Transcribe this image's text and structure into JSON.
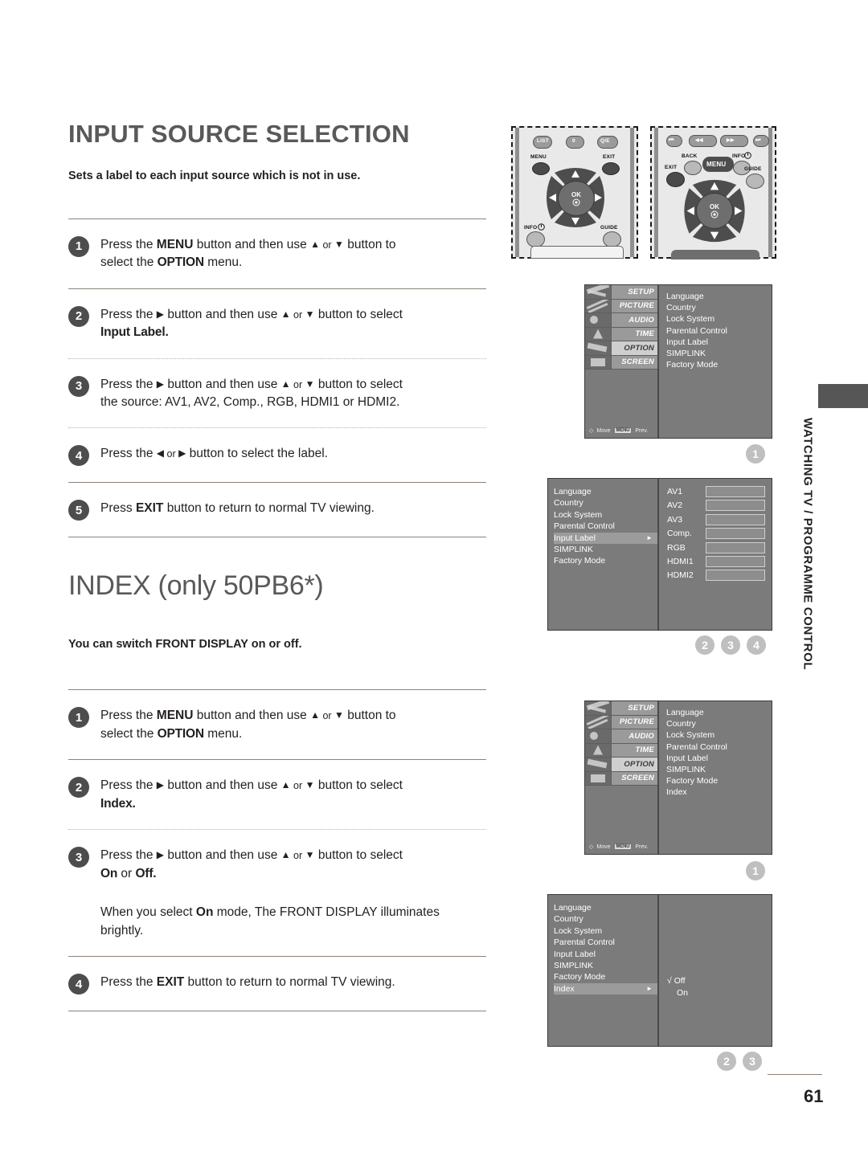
{
  "page": {
    "number": "61",
    "side_tab_text": "WATCHING TV / PROGRAMME CONTROL"
  },
  "section1": {
    "title": "INPUT SOURCE SELECTION",
    "lead": "Sets a label to each input source which is not in use.",
    "steps": [
      {
        "num": "1",
        "line1_a": "Press the ",
        "bold1": "MENU",
        "line1_b": " button and then use ",
        "up": "▲",
        "or": " or ",
        "down": "▼",
        "line1_c": " button to",
        "line2_a": "select the ",
        "bold2": "OPTION",
        "line2_b": " menu."
      },
      {
        "num": "2",
        "line1_a": "Press the ",
        "right": "▶",
        "line1_b": " button and then use ",
        "up": "▲",
        "or": " or ",
        "down": "▼",
        "line1_c": " button to select",
        "line2_bold": "Input Label."
      },
      {
        "num": "3",
        "line1_a": "Press the ",
        "right": "▶",
        "line1_b": " button and then use ",
        "up": "▲",
        "or": " or ",
        "down": "▼",
        "line1_c": " button to select",
        "line2": "the source: AV1, AV2, Comp., RGB, HDMI1 or HDMI2."
      },
      {
        "num": "4",
        "line1_a": "Press the ",
        "left": "◀",
        "or": " or ",
        "right": "▶",
        "line1_b": " button to select the label."
      },
      {
        "num": "5",
        "line1_a": "Press ",
        "bold1": "EXIT",
        "line1_b": " button to return to normal TV viewing."
      }
    ]
  },
  "section2": {
    "title": "INDEX (only 50PB6*)",
    "lead": "You can switch FRONT DISPLAY on or off.",
    "steps": [
      {
        "num": "1",
        "line1_a": "Press the ",
        "bold1": "MENU",
        "line1_b": " button and then use ",
        "up": "▲",
        "or": " or ",
        "down": "▼",
        "line1_c": " button to",
        "line2_a": "select the ",
        "bold2": "OPTION",
        "line2_b": " menu."
      },
      {
        "num": "2",
        "line1_a": "Press the ",
        "right": "▶",
        "line1_b": " button and then use ",
        "up": "▲",
        "or": " or ",
        "down": "▼",
        "line1_c": " button to select",
        "line2_bold": "Index."
      },
      {
        "num": "3",
        "line1_a": "Press the ",
        "right": "▶",
        "line1_b": " button and then use ",
        "up": "▲",
        "or": " or ",
        "down": "▼",
        "line1_c": " button to select",
        "line2_bold_a": "On",
        "line2_mid": " or ",
        "line2_bold_b": "Off.",
        "note_a": "When you select ",
        "note_bold": "On",
        "note_b": " mode, The FRONT DISPLAY illuminates",
        "note_c": "brightly."
      },
      {
        "num": "4",
        "line1_a": "Press the ",
        "bold1": "EXIT",
        "line1_b": " button to return to normal TV viewing."
      }
    ]
  },
  "remote1": {
    "buttons": [
      "LIST",
      "0",
      "Q/E"
    ],
    "labels": {
      "menu": "MENU",
      "exit": "EXIT",
      "info": "INFO",
      "guide": "GUIDE",
      "ok": "OK"
    }
  },
  "remote2": {
    "transport": [
      "⏮",
      "◀◀",
      "▶▶",
      "⏭"
    ],
    "labels": {
      "back": "BACK",
      "menu": "MENU",
      "info": "INFO",
      "exit": "EXIT",
      "guide": "GUIDE",
      "ok": "OK"
    }
  },
  "osd": {
    "tabs": [
      {
        "name": "SETUP",
        "active": false
      },
      {
        "name": "PICTURE",
        "active": false
      },
      {
        "name": "AUDIO",
        "active": false
      },
      {
        "name": "TIME",
        "active": false
      },
      {
        "name": "OPTION",
        "active": true
      },
      {
        "name": "SCREEN",
        "active": false
      }
    ],
    "footer": {
      "move": "Move",
      "menu_key": "MENU",
      "prev": "Prev."
    },
    "option_items_1": [
      "Language",
      "Country",
      "Lock System",
      "Parental Control",
      "Input Label",
      "SIMPLINK",
      "Factory Mode"
    ],
    "option_items_2": [
      "Language",
      "Country",
      "Lock System",
      "Parental Control",
      "Input Label",
      "SIMPLINK",
      "Factory Mode",
      "Index"
    ],
    "input_label_menu": {
      "items": [
        "Language",
        "Country",
        "Lock System",
        "Parental Control",
        "Input Label",
        "SIMPLINK",
        "Factory Mode"
      ],
      "selected": "Input Label",
      "sources": [
        "AV1",
        "AV2",
        "AV3",
        "Comp.",
        "RGB",
        "HDMI1",
        "HDMI2"
      ]
    },
    "index_menu": {
      "items": [
        "Language",
        "Country",
        "Lock System",
        "Parental Control",
        "Input Label",
        "SIMPLINK",
        "Factory Mode",
        "Index"
      ],
      "selected": "Index",
      "options": [
        "Off",
        "On"
      ],
      "checked": "Off",
      "check_glyph": "√"
    }
  },
  "markers": {
    "set1": [
      "1"
    ],
    "set2": [
      "2",
      "3",
      "4"
    ],
    "set3": [
      "1"
    ],
    "set4": [
      "2",
      "3"
    ]
  }
}
